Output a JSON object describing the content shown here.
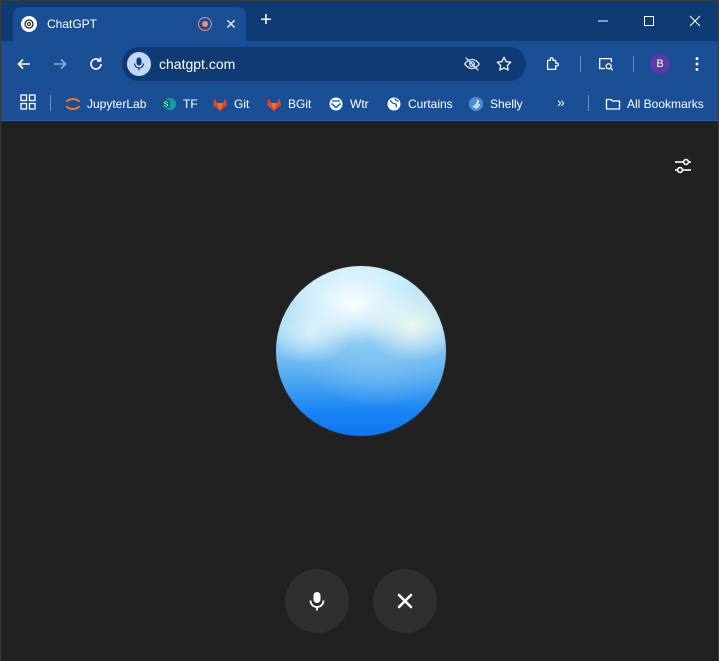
{
  "tab": {
    "title": "ChatGPT",
    "favicon": "openai-logo-icon",
    "recording_indicator": "recording-icon",
    "close": "close-icon"
  },
  "window_controls": [
    "minimize-icon",
    "maximize-icon",
    "close-icon"
  ],
  "toolbar": {
    "url": "chatgpt.com",
    "icons": [
      "back-arrow-icon",
      "forward-arrow-icon",
      "reload-icon",
      "microphone-icon",
      "eye-off-icon",
      "star-icon",
      "extensions-icon",
      "search-tab-icon",
      "more-vertical-icon"
    ],
    "profile_initial": "B"
  },
  "bookmarks": {
    "items": [
      {
        "label": "JupyterLab",
        "icon": "jupyter-icon"
      },
      {
        "label": "TF",
        "icon": "sharepoint-icon"
      },
      {
        "label": "Git",
        "icon": "gitlab-icon"
      },
      {
        "label": "BGit",
        "icon": "gitlab-icon"
      },
      {
        "label": "Wtr",
        "icon": "weather-icon"
      },
      {
        "label": "Curtains",
        "icon": "globe-icon"
      },
      {
        "label": "Shelly",
        "icon": "shelly-icon"
      }
    ],
    "overflow": "»",
    "all_bookmarks": "All Bookmarks"
  },
  "voice": {
    "settings_icon": "sliders-icon",
    "mic_button_icon": "microphone-icon",
    "close_button_icon": "close-icon"
  },
  "colors": {
    "tab_strip": "#0f3b74",
    "toolbar": "#1a4f96",
    "content_bg": "#212121",
    "control_button": "#2f2f2f",
    "orb_blue": "#1a85f4"
  }
}
